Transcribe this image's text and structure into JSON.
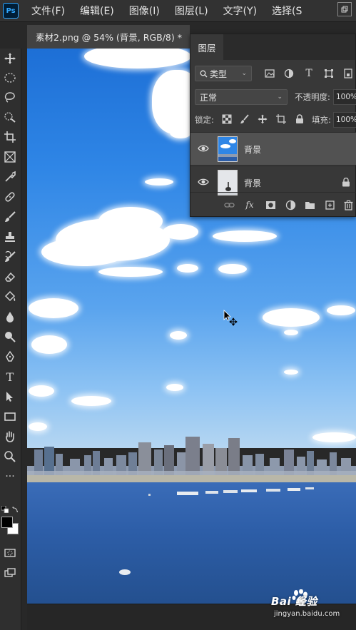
{
  "app": {
    "logo_text": "Ps",
    "menu": [
      "文件(F)",
      "编辑(E)",
      "图像(I)",
      "图层(L)",
      "文字(Y)",
      "选择(S"
    ]
  },
  "document_tab": {
    "title": "素材2.png @ 54% (背景, RGB/8) *",
    "close_glyph": "×"
  },
  "toolbar": {
    "tools": [
      "move-tool-icon",
      "marquee-tool-icon",
      "lasso-tool-icon",
      "quick-select-tool-icon",
      "crop-tool-icon",
      "frame-tool-icon",
      "eyedropper-tool-icon",
      "healing-brush-tool-icon",
      "brush-tool-icon",
      "stamp-tool-icon",
      "history-brush-tool-icon",
      "eraser-tool-icon",
      "paint-bucket-tool-icon",
      "blur-tool-icon",
      "dodge-tool-icon",
      "pen-tool-icon",
      "type-tool-icon",
      "path-select-tool-icon",
      "rectangle-tool-icon",
      "hand-tool-icon",
      "zoom-tool-icon",
      "more-tools-icon"
    ],
    "type_tool_glyph": "T",
    "more_glyph": "···",
    "foreground_color": "#000000",
    "background_color": "#ffffff"
  },
  "layers_panel": {
    "tab_label": "图层",
    "filter": {
      "label": "类型",
      "icon": "search-icon"
    },
    "blend_mode": "正常",
    "opacity_label": "不透明度:",
    "opacity_value": "100%",
    "lock_label": "锁定:",
    "fill_label": "填充:",
    "fill_value": "100%",
    "layers": [
      {
        "name": "背景",
        "selected": true,
        "visible": true,
        "locked": false
      },
      {
        "name": "背景",
        "selected": false,
        "visible": true,
        "locked": true
      }
    ],
    "footer_fx": "fx"
  },
  "watermark": {
    "brand": "Bai  经验",
    "url": "jingyan.baidu.com"
  },
  "colors": {
    "ps_blue": "#31a8ff",
    "panel_bg": "#383838",
    "menubar_bg": "#323232"
  }
}
